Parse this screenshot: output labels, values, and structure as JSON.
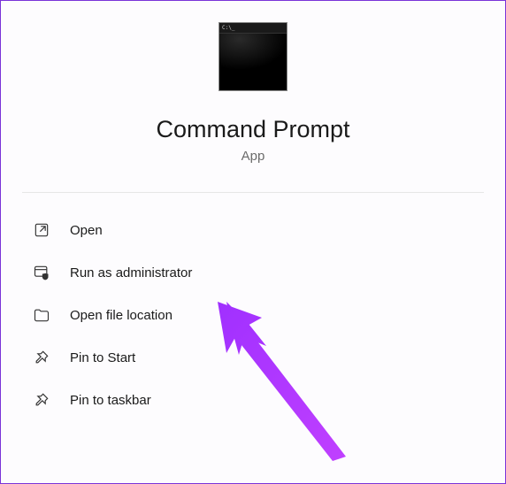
{
  "header": {
    "app_name": "Command Prompt",
    "app_type": "App",
    "icon_prompt": "C:\\_"
  },
  "menu": {
    "items": [
      {
        "label": "Open"
      },
      {
        "label": "Run as administrator"
      },
      {
        "label": "Open file location"
      },
      {
        "label": "Pin to Start"
      },
      {
        "label": "Pin to taskbar"
      }
    ]
  }
}
